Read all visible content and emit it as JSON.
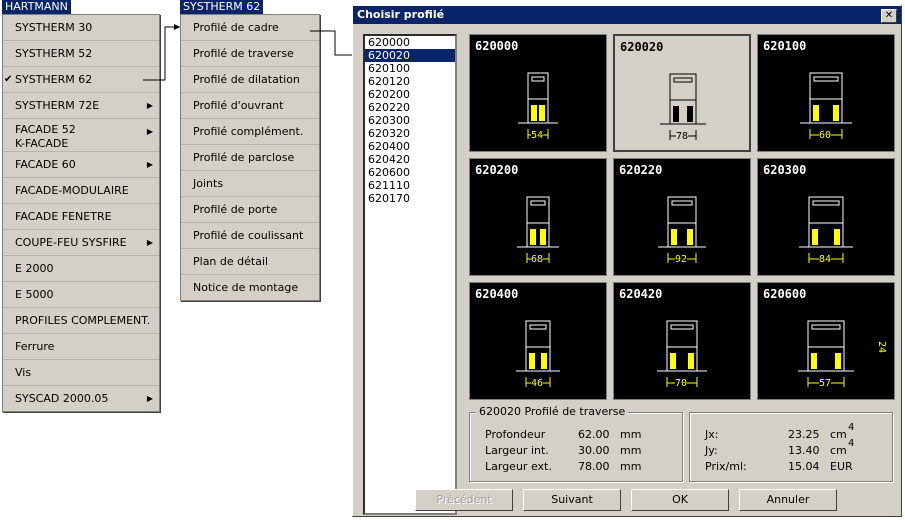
{
  "menu1": {
    "title": "HARTMANN",
    "items": [
      {
        "label": "SYSTHERM 30"
      },
      {
        "label": "SYSTHERM 52"
      },
      {
        "label": "SYSTHERM 62",
        "checked": true
      },
      {
        "label": "SYSTHERM 72E",
        "submenu": true
      },
      {
        "label": "FACADE  52",
        "label2": "K-FACADE",
        "submenu": true
      },
      {
        "label": "FACADE 60",
        "submenu": true
      },
      {
        "label": "FACADE-MODULAIRE"
      },
      {
        "label": "FACADE FENETRE"
      },
      {
        "label": "COUPE-FEU SYSFIRE",
        "submenu": true
      },
      {
        "label": "E 2000"
      },
      {
        "label": "E 5000"
      },
      {
        "label": "PROFILES COMPLEMENT."
      },
      {
        "label": "Ferrure"
      },
      {
        "label": "Vis"
      },
      {
        "label": "SYSCAD 2000.05",
        "submenu": true
      }
    ]
  },
  "menu2": {
    "title": "SYSTHERM 62",
    "items": [
      "Profilé de cadre",
      "Profilé de traverse",
      "Profilé de dilatation",
      "Profilé d'ouvrant",
      "Profilé complément.",
      "Profilé de parclose",
      "Joints",
      "Profilé de porte",
      "Profilé de coulissant",
      "Plan de détail",
      "Notice de montage"
    ]
  },
  "dialog": {
    "title": "Choisir profilé",
    "close_glyph": "✕",
    "list": [
      "620000",
      "620020",
      "620100",
      "620120",
      "620200",
      "620220",
      "620300",
      "620320",
      "620400",
      "620420",
      "620600",
      "621110",
      "620170"
    ],
    "selected": "620020",
    "tiles": [
      {
        "code": "620000",
        "dim": "54"
      },
      {
        "code": "620020",
        "dim": "78"
      },
      {
        "code": "620100",
        "dim": "60"
      },
      {
        "code": "620200",
        "dim": "68"
      },
      {
        "code": "620220",
        "dim": "92"
      },
      {
        "code": "620300",
        "dim": "84"
      },
      {
        "code": "620400",
        "dim": "46"
      },
      {
        "code": "620420",
        "dim": "70"
      },
      {
        "code": "620600",
        "dim": "57",
        "dim2": "24"
      }
    ],
    "info": {
      "caption": "620020   Profilé de traverse",
      "profondeur_label": "Profondeur",
      "profondeur_value": "62.00",
      "profondeur_unit": "mm",
      "largeur_int_label": "Largeur int.",
      "largeur_int_value": "30.00",
      "largeur_int_unit": "mm",
      "largeur_ext_label": "Largeur ext.",
      "largeur_ext_value": "78.00",
      "largeur_ext_unit": "mm",
      "jx_label": "Jx:",
      "jx_value": "23.25",
      "jx_unit": "cm",
      "jx_exp": "4",
      "jy_label": "Jy:",
      "jy_value": "13.40",
      "jy_unit": "cm",
      "jy_exp": "4",
      "prix_label": "Prix/ml:",
      "prix_value": "15.04",
      "prix_unit": "EUR"
    },
    "buttons": {
      "prev": "Précédent",
      "next": "Suivant",
      "ok": "OK",
      "cancel": "Annuler"
    }
  },
  "colors": {
    "selection": "#0a246a",
    "face": "#d4d0c8",
    "dimension": "#ffff00"
  }
}
